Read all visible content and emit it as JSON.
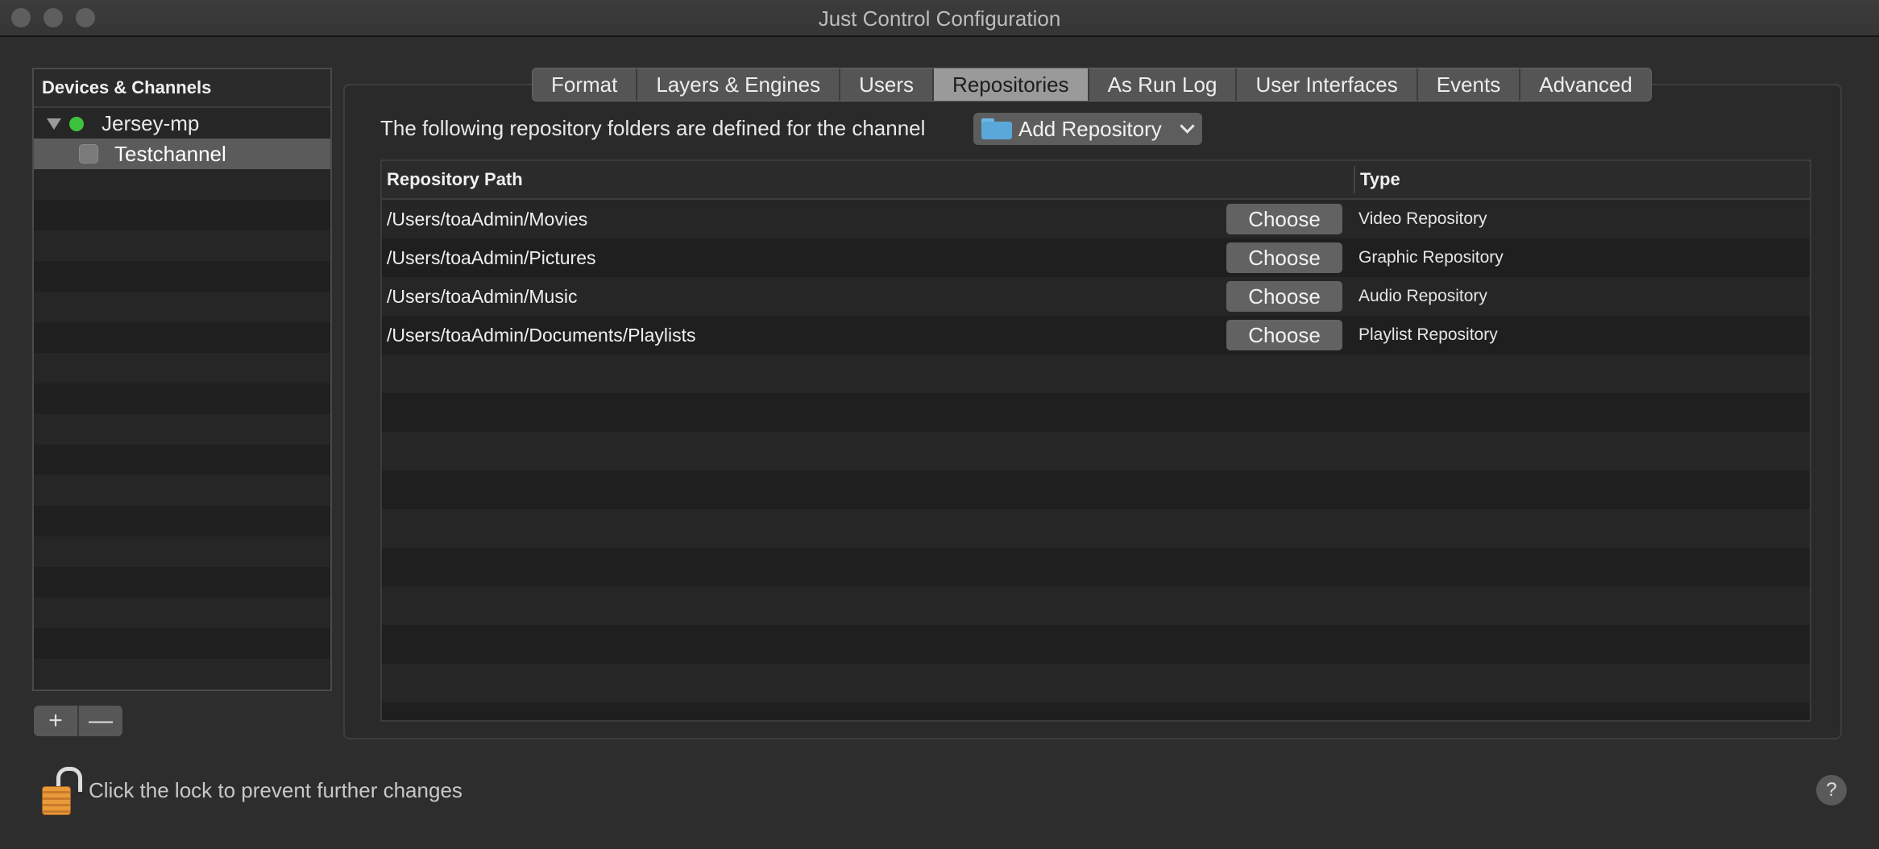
{
  "window": {
    "title": "Just Control Configuration"
  },
  "sidebar": {
    "header": "Devices & Channels",
    "device": {
      "name": "Jersey-mp",
      "status_color": "#3ec23e"
    },
    "channel": {
      "name": "Testchannel"
    },
    "add_label": "+",
    "remove_label": "—"
  },
  "tabs": [
    {
      "label": "Format"
    },
    {
      "label": "Layers & Engines"
    },
    {
      "label": "Users"
    },
    {
      "label": "Repositories",
      "active": true
    },
    {
      "label": "As Run Log"
    },
    {
      "label": "User Interfaces"
    },
    {
      "label": "Events"
    },
    {
      "label": "Advanced"
    }
  ],
  "repositories": {
    "intro": "The following repository folders are defined for the channel",
    "add_button": "Add Repository",
    "columns": {
      "path": "Repository Path",
      "type": "Type"
    },
    "rows": [
      {
        "path": "/Users/toaAdmin/Movies",
        "choose": "Choose",
        "type": "Video Repository"
      },
      {
        "path": "/Users/toaAdmin/Pictures",
        "choose": "Choose",
        "type": "Graphic Repository"
      },
      {
        "path": "/Users/toaAdmin/Music",
        "choose": "Choose",
        "type": "Audio Repository"
      },
      {
        "path": "/Users/toaAdmin/Documents/Playlists",
        "choose": "Choose",
        "type": "Playlist Repository"
      }
    ]
  },
  "footer": {
    "lock_text": "Click the lock to prevent further changes",
    "help_label": "?"
  }
}
